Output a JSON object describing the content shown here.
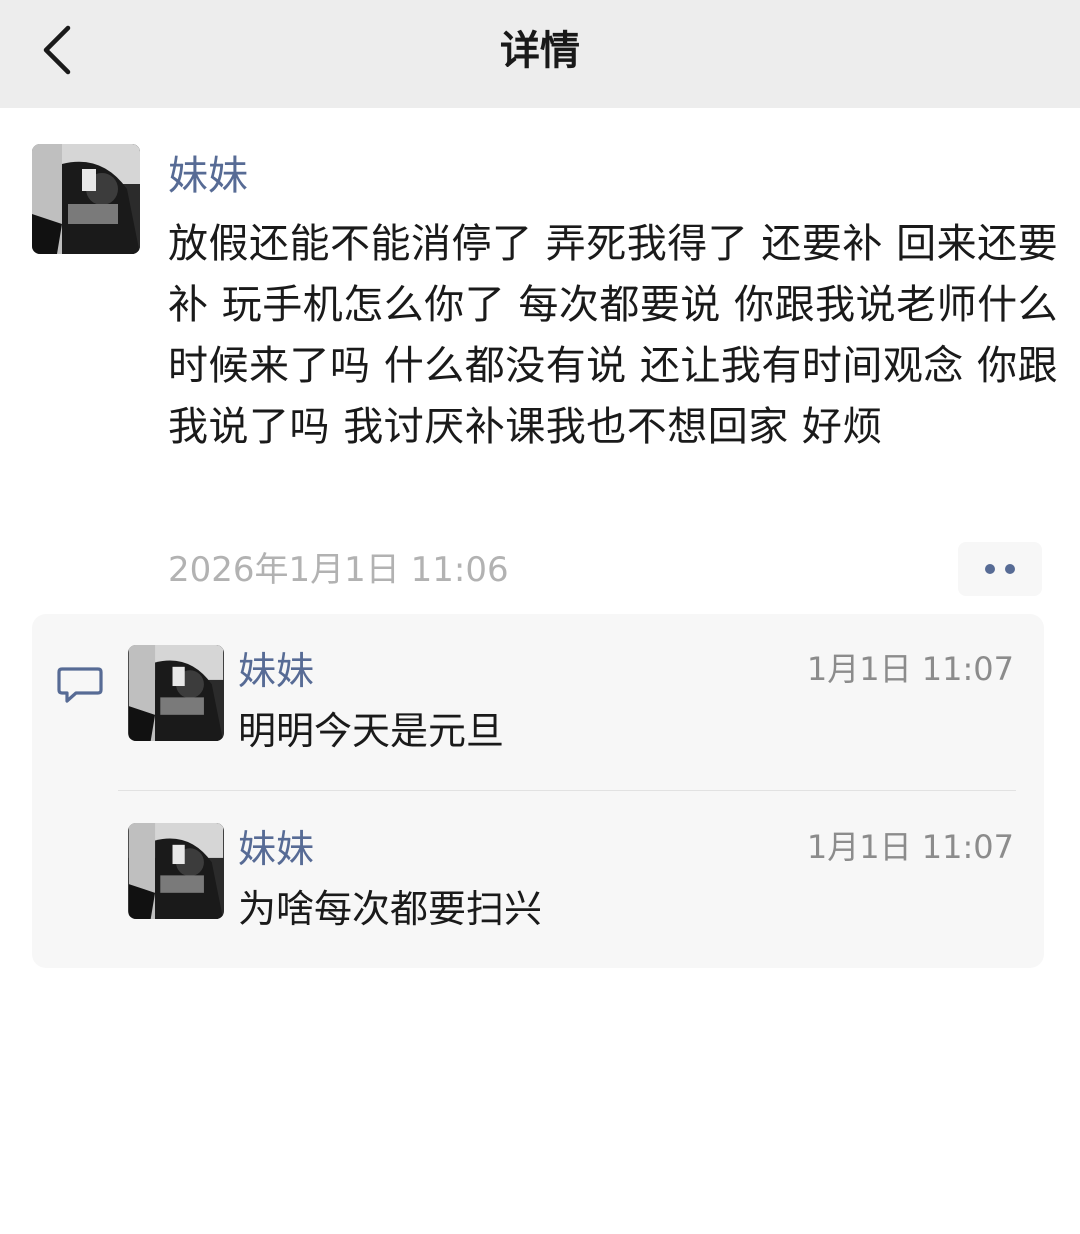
{
  "nav": {
    "title": "详情",
    "back_icon": "chevron-left-icon"
  },
  "post": {
    "author": "妹妹",
    "text": "放假还能不能消停了 弄死我得了 还要补 回来还要补 玩手机怎么你了 每次都要说 你跟我说老师什么时候来了吗 什么都没有说 还让我有时间观念 你跟我说了吗 我讨厌补课我也不想回家 好烦",
    "time": "2026年1月1日 11:06",
    "more_icon": "two-dots-icon"
  },
  "comments_icon": "comment-bubble-icon",
  "comments": [
    {
      "author": "妹妹",
      "text": "明明今天是元旦",
      "time": "1月1日 11:07"
    },
    {
      "author": "妹妹",
      "text": "为啥每次都要扫兴",
      "time": "1月1日 11:07"
    }
  ],
  "colors": {
    "nav_bg": "#ededed",
    "link_blue": "#576b95",
    "panel_bg": "#f7f7f7",
    "muted_text": "#b2b2b2"
  }
}
